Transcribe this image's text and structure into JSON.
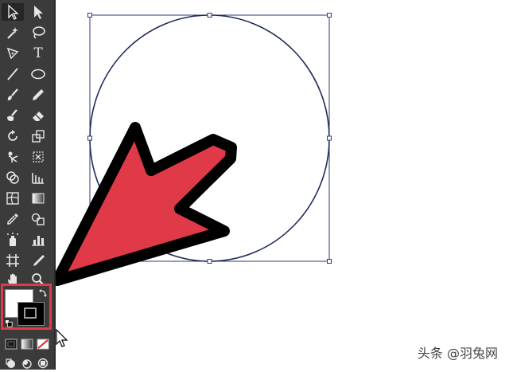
{
  "toolbar": {
    "tools": [
      {
        "icon": "selection-arrow-icon"
      },
      {
        "icon": "direct-selection-arrow-icon"
      },
      {
        "icon": "magic-wand-icon"
      },
      {
        "icon": "lasso-icon"
      },
      {
        "icon": "pen-icon"
      },
      {
        "icon": "type-icon",
        "glyph": "T"
      },
      {
        "icon": "line-segment-icon"
      },
      {
        "icon": "ellipse-icon"
      },
      {
        "icon": "paintbrush-icon"
      },
      {
        "icon": "pencil-icon"
      },
      {
        "icon": "blob-brush-icon"
      },
      {
        "icon": "eraser-icon"
      },
      {
        "icon": "rotate-icon"
      },
      {
        "icon": "scale-icon"
      },
      {
        "icon": "puppet-warp-icon"
      },
      {
        "icon": "free-transform-icon"
      },
      {
        "icon": "shape-builder-icon"
      },
      {
        "icon": "perspective-grid-icon"
      },
      {
        "icon": "mesh-icon"
      },
      {
        "icon": "gradient-icon"
      },
      {
        "icon": "eyedropper-icon"
      },
      {
        "icon": "blend-icon"
      },
      {
        "icon": "symbol-sprayer-icon"
      },
      {
        "icon": "column-graph-icon"
      },
      {
        "icon": "artboard-icon"
      },
      {
        "icon": "slice-icon"
      },
      {
        "icon": "hand-icon"
      },
      {
        "icon": "zoom-icon"
      }
    ],
    "fill_stroke": {
      "fill_color": "#ffffff",
      "stroke_color": "#000000",
      "highlight_color": "#e03a48"
    },
    "color_modes": [
      {
        "icon": "color-icon"
      },
      {
        "icon": "gradient-mode-icon"
      },
      {
        "icon": "none-icon"
      }
    ],
    "draw_modes": [
      {
        "icon": "draw-normal-icon"
      },
      {
        "icon": "draw-behind-icon"
      },
      {
        "icon": "draw-inside-icon"
      }
    ]
  },
  "canvas": {
    "shape": "ellipse",
    "selection_color": "#2e3a78",
    "annotation_arrow_color": "#e03a48"
  },
  "watermark": {
    "text": "头条 @羽兔网"
  }
}
